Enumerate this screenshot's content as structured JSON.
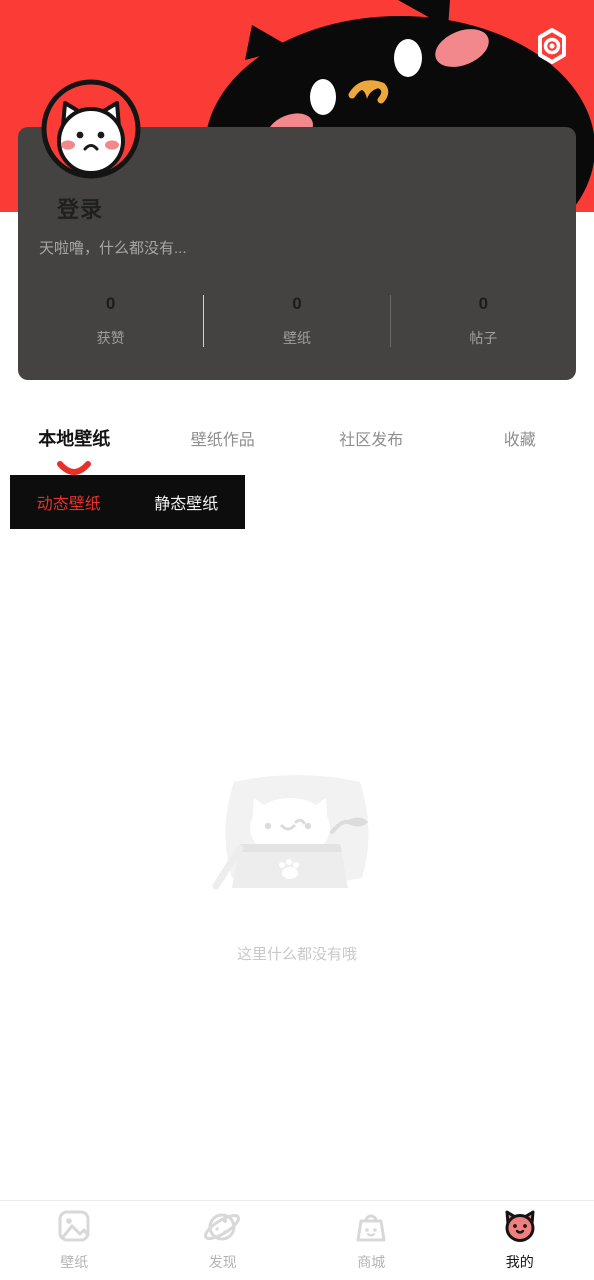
{
  "theme": {
    "brand_red": "#FB3B36",
    "accent_red": "#E8302A",
    "card_gray": "#454341",
    "pill_black": "#0D0D0D",
    "active_pink": "#F08080",
    "muted_text": "#B5B5B5"
  },
  "header": {
    "settings_icon": "gear-hexagon-icon",
    "banner_art": "black-cat-face-illustration",
    "avatar_icon": "white-cat-avatar"
  },
  "profile": {
    "login_label": "登录",
    "subtitle": "天啦噜，什么都没有...",
    "stats": [
      {
        "value": "0",
        "label": "获赞"
      },
      {
        "value": "0",
        "label": "壁纸"
      },
      {
        "value": "0",
        "label": "帖子"
      }
    ]
  },
  "tabs": [
    {
      "label": "本地壁纸",
      "active": true
    },
    {
      "label": "壁纸作品",
      "active": false
    },
    {
      "label": "社区发布",
      "active": false
    },
    {
      "label": "收藏",
      "active": false
    }
  ],
  "subtabs": [
    {
      "label": "动态壁纸",
      "active": true
    },
    {
      "label": "静态壁纸",
      "active": false
    }
  ],
  "empty_state": {
    "illustration": "cat-in-box-illustration",
    "text": "这里什么都没有哦"
  },
  "bottom_nav": [
    {
      "label": "壁纸",
      "icon": "image-icon",
      "active": false
    },
    {
      "label": "发现",
      "icon": "planet-icon",
      "active": false
    },
    {
      "label": "商城",
      "icon": "shopping-bag-cat-icon",
      "active": false
    },
    {
      "label": "我的",
      "icon": "cat-face-icon",
      "active": true
    }
  ]
}
